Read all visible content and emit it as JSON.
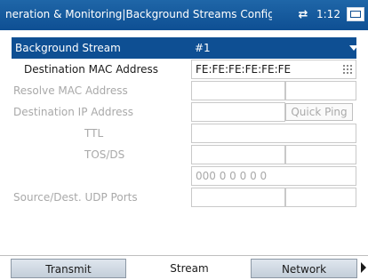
{
  "titlebar": {
    "title": "neration & Monitoring|Background Streams Config",
    "time": "1:12"
  },
  "header": {
    "label": "Background Stream",
    "value": "#1"
  },
  "rows": {
    "dest_mac": {
      "label": "Destination MAC Address",
      "value": "FE:FE:FE:FE:FE:FE"
    },
    "resolve_mac": {
      "label": "Resolve MAC Address"
    },
    "dest_ip": {
      "label": "Destination IP Address",
      "button": "Quick Ping"
    },
    "ttl": {
      "label": "TTL"
    },
    "tos": {
      "label": "TOS/DS",
      "bits": "000 0 0 0 0 0"
    },
    "ports": {
      "label": "Source/Dest. UDP Ports"
    }
  },
  "tabs": [
    {
      "label": "Transmit",
      "active": false
    },
    {
      "label": "Stream",
      "active": true
    },
    {
      "label": "Network",
      "active": false
    }
  ],
  "colors": {
    "titlebar": "#0e4f93",
    "header": "#0e4f93",
    "disabled_text": "#a9a9a9"
  }
}
